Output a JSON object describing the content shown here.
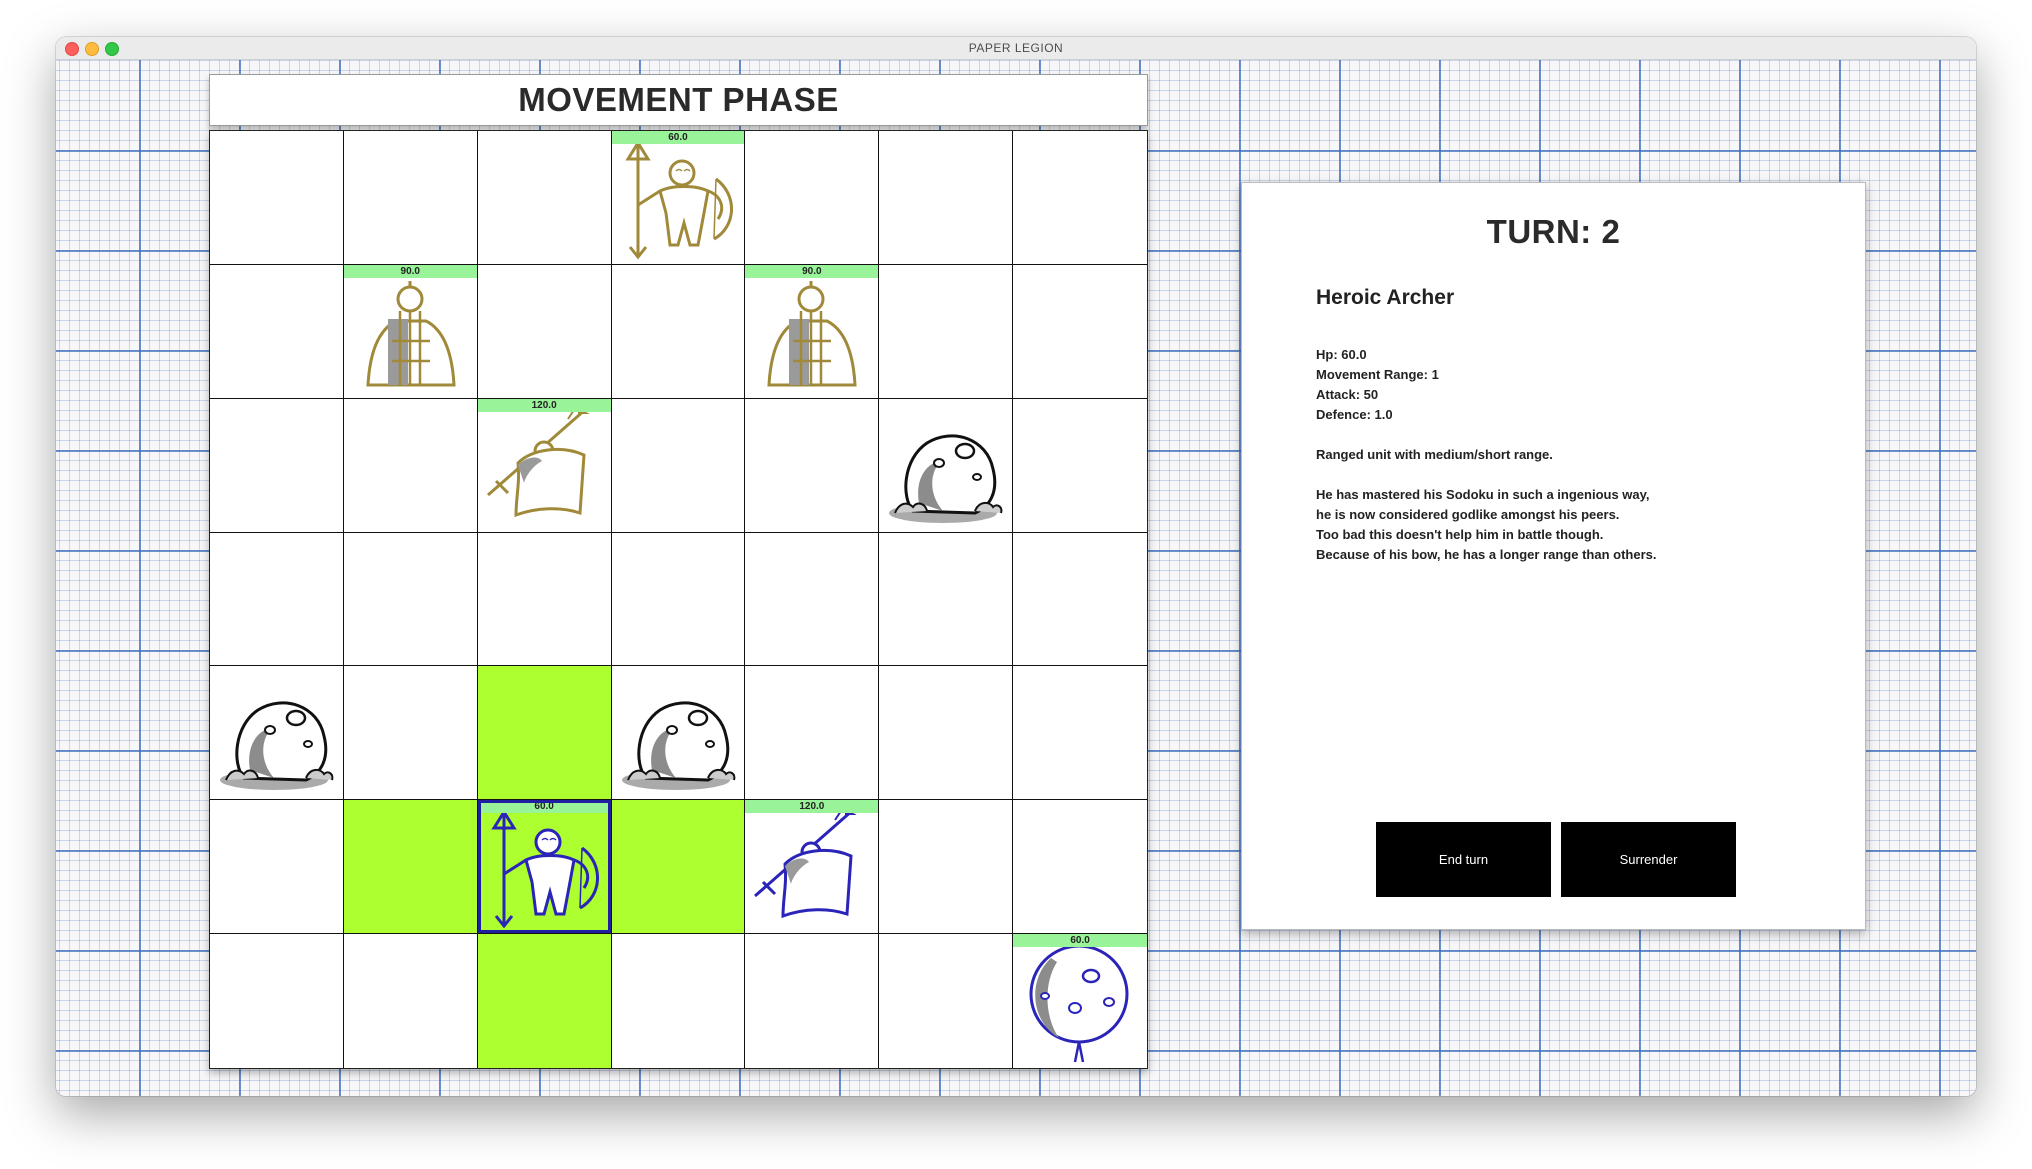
{
  "window": {
    "title": "PAPER LEGION"
  },
  "phase": {
    "title": "MOVEMENT PHASE"
  },
  "board": {
    "cells": [
      [
        null,
        null,
        null,
        {
          "unit": "archer",
          "team": "gold",
          "hp": "60.0"
        },
        null,
        null,
        null
      ],
      [
        null,
        {
          "unit": "tower",
          "team": "gold",
          "hp": "90.0"
        },
        null,
        null,
        {
          "unit": "tower",
          "team": "gold",
          "hp": "90.0"
        },
        null,
        null
      ],
      [
        null,
        null,
        {
          "unit": "swordsman",
          "team": "gold",
          "hp": "120.0"
        },
        null,
        null,
        {
          "unit": "rock"
        },
        null
      ],
      [
        null,
        null,
        null,
        null,
        null,
        null,
        null
      ],
      [
        {
          "unit": "rock"
        },
        null,
        {
          "highlight": "move"
        },
        {
          "unit": "rock"
        },
        null,
        null,
        null
      ],
      [
        null,
        {
          "highlight": "move"
        },
        {
          "unit": "archer",
          "team": "blue",
          "hp": "60.0",
          "selected": true
        },
        {
          "highlight": "move"
        },
        {
          "unit": "swordsman",
          "team": "blue",
          "hp": "120.0"
        },
        null,
        null
      ],
      [
        null,
        null,
        {
          "highlight": "move"
        },
        null,
        null,
        null,
        {
          "unit": "balloon",
          "team": "blue",
          "hp": "60.0"
        }
      ]
    ]
  },
  "colors": {
    "gold_team": "#a08a3a",
    "blue_team": "#2a24b8",
    "move_highlight": "#adff2f",
    "hp_bar": "#99f399"
  },
  "info": {
    "turn": "TURN: 2",
    "unit_name": "Heroic Archer",
    "stats": {
      "hp": "Hp: 60.0",
      "movement": "Movement Range: 1",
      "attack": "Attack: 50",
      "defence": "Defence: 1.0"
    },
    "description": "Ranged unit with medium/short range.",
    "lore": [
      "He has mastered his Sodoku in such a ingenious way,",
      "he is now considered godlike amongst his peers.",
      "Too bad this doesn't help him in battle though.",
      "Because of his bow, he has a longer range than others."
    ],
    "buttons": {
      "end_turn": "End turn",
      "surrender": "Surrender"
    }
  }
}
